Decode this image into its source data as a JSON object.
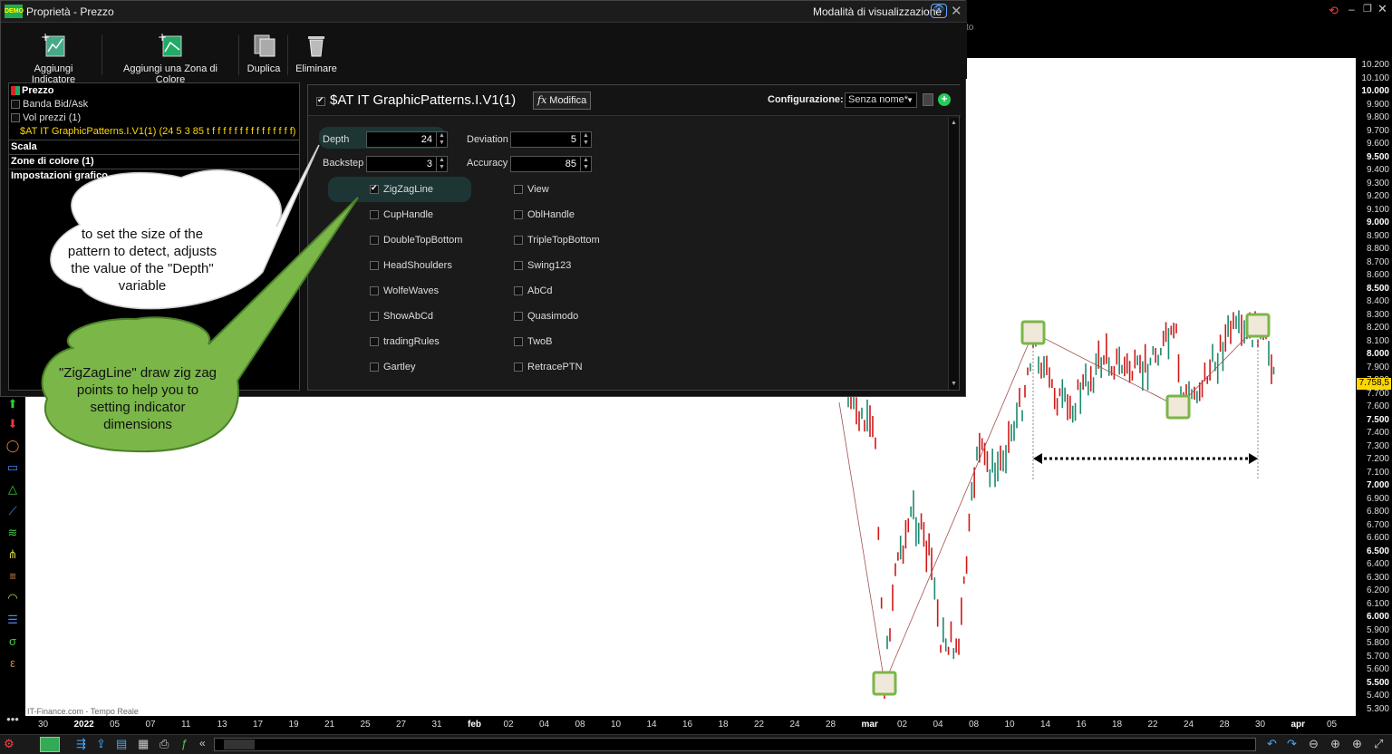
{
  "dialog": {
    "title": "Proprietà - Prezzo",
    "display_mode": "Modalità di visualizzazione",
    "toolbar": [
      "Aggiungi Indicatore",
      "Aggiungi una Zona di Colore",
      "Duplica",
      "Eliminare"
    ]
  },
  "tree": {
    "price": "Prezzo",
    "items": [
      {
        "label": "Banda Bid/Ask",
        "checked": false
      },
      {
        "label": "Vol prezzi (1)",
        "checked": false
      }
    ],
    "indicator": "$AT IT GraphicPatterns.I.V1(1) (24 5 3 85 t f f f f f f f f f f f f f f f)",
    "sections": [
      "Scala",
      "Zone di colore (1)",
      "Impostazioni grafico"
    ]
  },
  "props": {
    "indicator_title": "$AT IT GraphicPatterns.I.V1(1)",
    "modify_label": "Modifica",
    "fx_label": "fx",
    "config_label": "Configurazione:",
    "config_value": "Senza nome*",
    "fields": {
      "depth": {
        "label": "Depth",
        "value": "24"
      },
      "deviation": {
        "label": "Deviation",
        "value": "5"
      },
      "backstep": {
        "label": "Backstep",
        "value": "3"
      },
      "accuracy": {
        "label": "Accuracy",
        "value": "85"
      }
    },
    "left_checks": [
      {
        "label": "ZigZagLine",
        "checked": true
      },
      {
        "label": "CupHandle",
        "checked": false
      },
      {
        "label": "DoubleTopBottom",
        "checked": false
      },
      {
        "label": "HeadShoulders",
        "checked": false
      },
      {
        "label": "WolfeWaves",
        "checked": false
      },
      {
        "label": "ShowAbCd",
        "checked": false
      },
      {
        "label": "tradingRules",
        "checked": false
      },
      {
        "label": "Gartley",
        "checked": false
      }
    ],
    "right_checks": [
      {
        "label": "View",
        "checked": false
      },
      {
        "label": "OblHandle",
        "checked": false
      },
      {
        "label": "TripleTopBottom",
        "checked": false
      },
      {
        "label": "Swing123",
        "checked": false
      },
      {
        "label": "AbCd",
        "checked": false
      },
      {
        "label": "Quasimodo",
        "checked": false
      },
      {
        "label": "TwoB",
        "checked": false
      },
      {
        "label": "RetracePTN",
        "checked": false
      }
    ]
  },
  "callouts": {
    "depth": "to set the size of the pattern to detect, adjusts the value of the \"Depth\" variable",
    "zigzag": "\"ZigZagLine\" draw zig zag points to help you to setting indicator dimensions"
  },
  "chart": {
    "source": "IT-Finance.com - Tempo Reale",
    "header_fragment": "to",
    "last_price": "7.758,5",
    "price_ticks": [
      "10.200",
      "10.100",
      "10.000",
      "9.900",
      "9.800",
      "9.700",
      "9.600",
      "9.500",
      "9.400",
      "9.300",
      "9.200",
      "9.100",
      "9.000",
      "8.900",
      "8.800",
      "8.700",
      "8.600",
      "8.500",
      "8.400",
      "8.300",
      "8.200",
      "8.100",
      "8.000",
      "7.900",
      "7.800",
      "7.700",
      "7.600",
      "7.500",
      "7.400",
      "7.300",
      "7.200",
      "7.100",
      "7.000",
      "6.900",
      "6.800",
      "6.700",
      "6.600",
      "6.500",
      "6.400",
      "6.300",
      "6.200",
      "6.100",
      "6.000",
      "5.900",
      "5.800",
      "5.700",
      "5.600",
      "5.500",
      "5.400",
      "5.300"
    ],
    "bold_ticks": [
      "10.000",
      "9.500",
      "9.000",
      "8.500",
      "8.000",
      "7.500",
      "7.000",
      "6.500",
      "6.000",
      "5.500"
    ],
    "date_ticks": [
      "30",
      "2022",
      "05",
      "07",
      "11",
      "13",
      "17",
      "19",
      "21",
      "25",
      "27",
      "31",
      "feb",
      "02",
      "04",
      "08",
      "10",
      "14",
      "16",
      "18",
      "22",
      "24",
      "28",
      "mar",
      "02",
      "04",
      "08",
      "10",
      "14",
      "16",
      "18",
      "22",
      "24",
      "28",
      "30",
      "apr",
      "05"
    ],
    "bold_dates": [
      "2022",
      "feb",
      "mar",
      "apr"
    ]
  },
  "colors": {
    "bull": "#1a8a6e",
    "bear": "#d01818",
    "callout_green": "#7ab648",
    "highlight": "#1e3a3a"
  }
}
